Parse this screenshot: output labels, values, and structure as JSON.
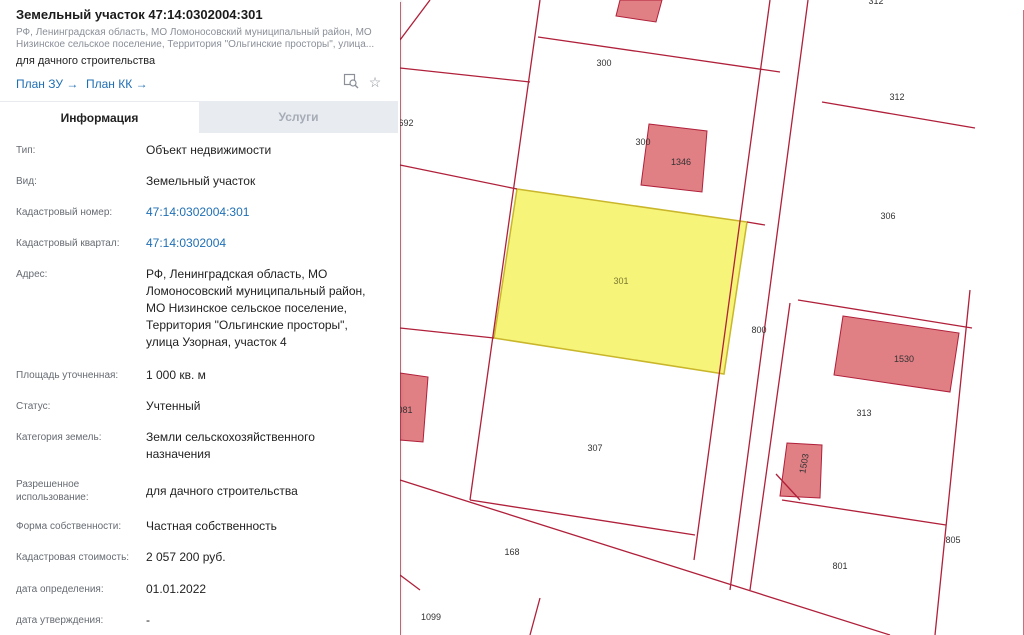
{
  "panel": {
    "title": "Земельный участок 47:14:0302004:301",
    "subtitle": "РФ, Ленинградская область, МО Ломоносовский муниципальный район, МО Низинское сельское поселение, Территория \"Ольгинские просторы\", улица...",
    "purpose": "для дачного строительства",
    "links": {
      "plan_zu": "План ЗУ →",
      "plan_kk": "План КК →"
    },
    "tabs": {
      "info": "Информация",
      "services": "Услуги"
    },
    "fields": [
      {
        "label": "Тип:",
        "value": "Объект недвижимости"
      },
      {
        "label": "Вид:",
        "value": "Земельный участок"
      },
      {
        "label": "Кадастровый номер:",
        "value": "47:14:0302004:301"
      },
      {
        "label": "Кадастровый квартал:",
        "value": "47:14:0302004"
      },
      {
        "label": "Адрес:",
        "value": "РФ, Ленинградская область, МО Ломоносовский муниципальный район, МО Низинское сельское поселение, Территория \"Ольгинские просторы\", улица Узорная, участок 4"
      },
      {
        "label": "Площадь уточненная:",
        "value": "1 000 кв. м"
      },
      {
        "label": "Статус:",
        "value": "Учтенный"
      },
      {
        "label": "Категория земель:",
        "value": "Земли сельскохозяйственного назначения"
      },
      {
        "label": "Разрешенное использование:",
        "value": "для дачного строительства"
      },
      {
        "label": "Форма собственности:",
        "value": "Частная собственность"
      },
      {
        "label": "Кадастровая стоимость:",
        "value": "2 057 200 руб."
      },
      {
        "label": "дата определения:",
        "value": "01.01.2022"
      },
      {
        "label": "дата утверждения:",
        "value": "-"
      }
    ]
  },
  "map": {
    "colors": {
      "boundary": "#b0203a",
      "building": "#e07f84",
      "selected": "#f7f47a",
      "selected_border": "#c9b62a"
    },
    "labels": {
      "l312a": "312",
      "l692": "692",
      "l300a": "300",
      "l300b": "300",
      "l1346": "1346",
      "l312b": "312",
      "l306": "306",
      "l301": "301",
      "l800": "800",
      "l1530": "1530",
      "l313": "313",
      "l1503": "1503",
      "l307": "307",
      "l081": "081",
      "l168": "168",
      "l805": "805",
      "l801": "801",
      "l1099": "1099"
    }
  }
}
